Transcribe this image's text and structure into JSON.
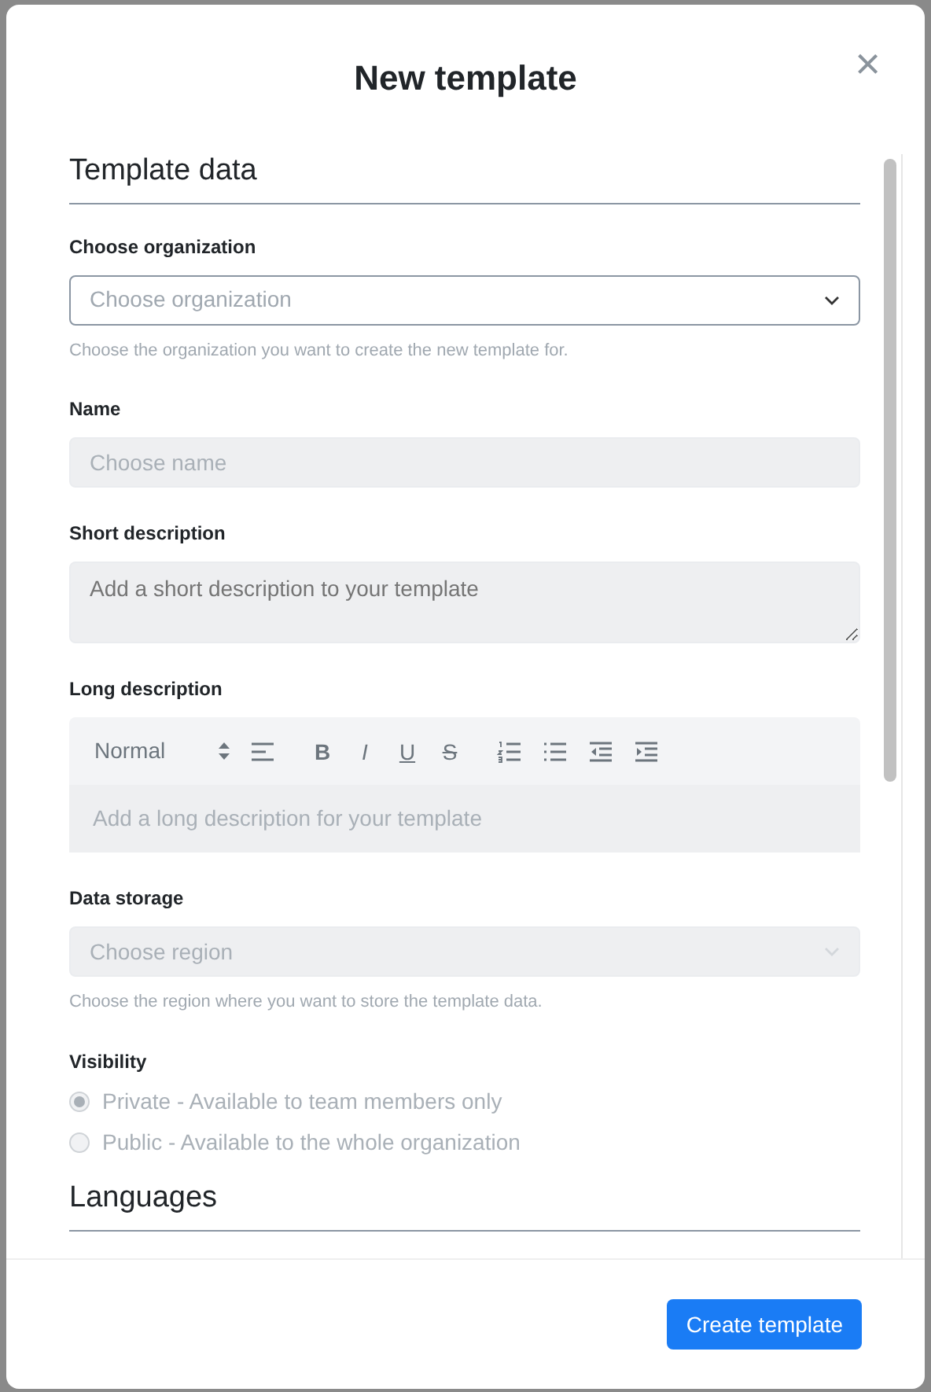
{
  "modal": {
    "title": "New template",
    "close": "×"
  },
  "sections": [
    {
      "title": "Template data",
      "fields": [
        {
          "kind": "select",
          "label": "Choose organization",
          "placeholder": "Choose organization",
          "help": "Choose the organization you want to create the new template for.",
          "disabled": false
        },
        {
          "kind": "input",
          "label": "Name",
          "placeholder": "Choose name",
          "disabled": true
        },
        {
          "kind": "textarea",
          "label": "Short description",
          "placeholder": "Add a short description to your template",
          "disabled": true
        },
        {
          "kind": "editor",
          "label": "Long description",
          "format": "Normal",
          "tools": [
            {
              "kind": "align"
            },
            {
              "kind": "letter",
              "label": "B"
            },
            {
              "kind": "letter",
              "label": "I"
            },
            {
              "kind": "letter",
              "label": "U"
            },
            {
              "kind": "letter",
              "label": "S"
            },
            {
              "kind": "ordered"
            },
            {
              "kind": "bullet"
            },
            {
              "kind": "outdent"
            },
            {
              "kind": "indent"
            }
          ],
          "placeholder": "Add a long description for your template",
          "disabled": true
        },
        {
          "kind": "select",
          "label": "Data storage",
          "placeholder": "Choose region",
          "help": "Choose the region where you want to store the template data.",
          "disabled": true
        },
        {
          "kind": "radios",
          "label": "Visibility",
          "disabled": true,
          "options": [
            {
              "label": "Private - Available to team members only",
              "selected": true
            },
            {
              "label": "Public - Available to the whole organization",
              "selected": false
            }
          ]
        }
      ]
    },
    {
      "title": "Languages"
    }
  ],
  "footer": {
    "button": "Create template"
  }
}
